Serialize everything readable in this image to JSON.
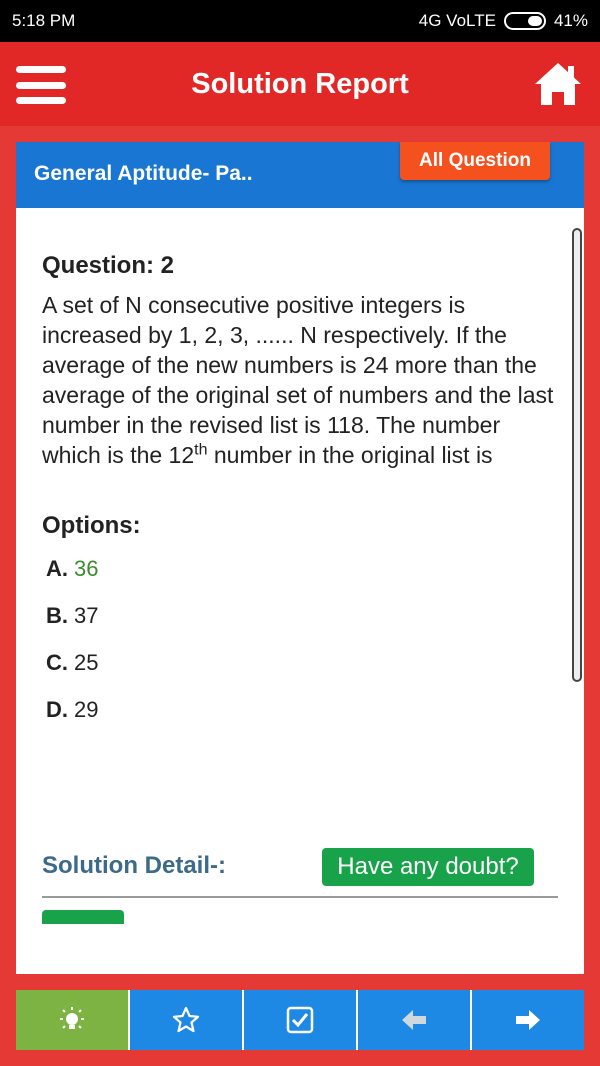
{
  "status": {
    "time": "5:18 PM",
    "network": "4G VoLTE",
    "battery": "41%"
  },
  "header": {
    "title": "Solution Report"
  },
  "panel": {
    "test_name": "General Aptitude- Pa..",
    "all_question_label": "All Question"
  },
  "question": {
    "title": "Question: 2",
    "text_before": "A set of N consecutive positive integers is increased by 1, 2, 3, ...... N respectively. If the average of the new numbers is 24 more than the average of the original set of numbers and the last number in the revised list is 118. The number which is the 12",
    "sup": "th",
    "text_after": " number in the original list is"
  },
  "options": {
    "title": "Options:",
    "items": [
      {
        "letter": "A.",
        "text": "36",
        "correct": true
      },
      {
        "letter": "B.",
        "text": "37",
        "correct": false
      },
      {
        "letter": "C.",
        "text": "25",
        "correct": false
      },
      {
        "letter": "D.",
        "text": "29",
        "correct": false
      }
    ]
  },
  "solution": {
    "title": "Solution Detail-:",
    "doubt_label": "Have any doubt?"
  },
  "colors": {
    "header_red": "#e22826",
    "panel_blue": "#1976d2",
    "correct_green": "#3c8a2e",
    "button_orange": "#f4511e",
    "doubt_green": "#18a34a",
    "active_tab": "#7cb342"
  },
  "bottom_tabs": [
    "bulb-icon",
    "star-icon",
    "checkbox-icon",
    "prev-arrow-icon",
    "next-arrow-icon"
  ]
}
